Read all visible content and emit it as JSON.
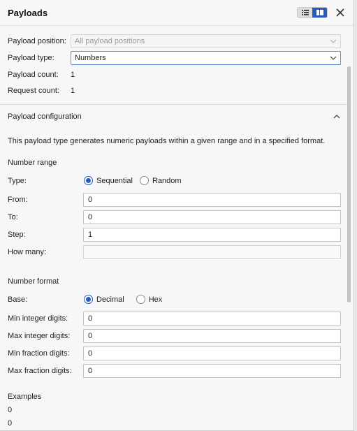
{
  "header": {
    "title": "Payloads"
  },
  "top": {
    "payload_position_label": "Payload position:",
    "payload_position_value": "All payload positions",
    "payload_type_label": "Payload type:",
    "payload_type_value": "Numbers",
    "payload_count_label": "Payload count:",
    "payload_count_value": "1",
    "request_count_label": "Request count:",
    "request_count_value": "1"
  },
  "config": {
    "section_title": "Payload configuration",
    "description": "This payload type generates numeric payloads within a given range and in a specified format.",
    "number_range": {
      "heading": "Number range",
      "type_label": "Type:",
      "options": [
        "Sequential",
        "Random"
      ],
      "selected": "Sequential",
      "from_label": "From:",
      "from_value": "0",
      "to_label": "To:",
      "to_value": "0",
      "step_label": "Step:",
      "step_value": "1",
      "how_many_label": "How many:",
      "how_many_value": ""
    },
    "number_format": {
      "heading": "Number format",
      "base_label": "Base:",
      "options": [
        "Decimal",
        "Hex"
      ],
      "selected": "Decimal",
      "min_int_label": "Min integer digits:",
      "min_int_value": "0",
      "max_int_label": "Max integer digits:",
      "max_int_value": "0",
      "min_frac_label": "Min fraction digits:",
      "min_frac_value": "0",
      "max_frac_label": "Max fraction digits:",
      "max_frac_value": "0"
    },
    "examples": {
      "heading": "Examples",
      "values": [
        "0",
        "0"
      ]
    }
  },
  "colors": {
    "accent": "#2b5bb8",
    "panel_bg": "#f7f7f7"
  },
  "icons": {
    "list_view": "list-view-icon",
    "split_view": "split-view-icon",
    "close": "close-icon",
    "collapse": "chevron-up-icon",
    "dropdown": "chevron-down-icon"
  }
}
